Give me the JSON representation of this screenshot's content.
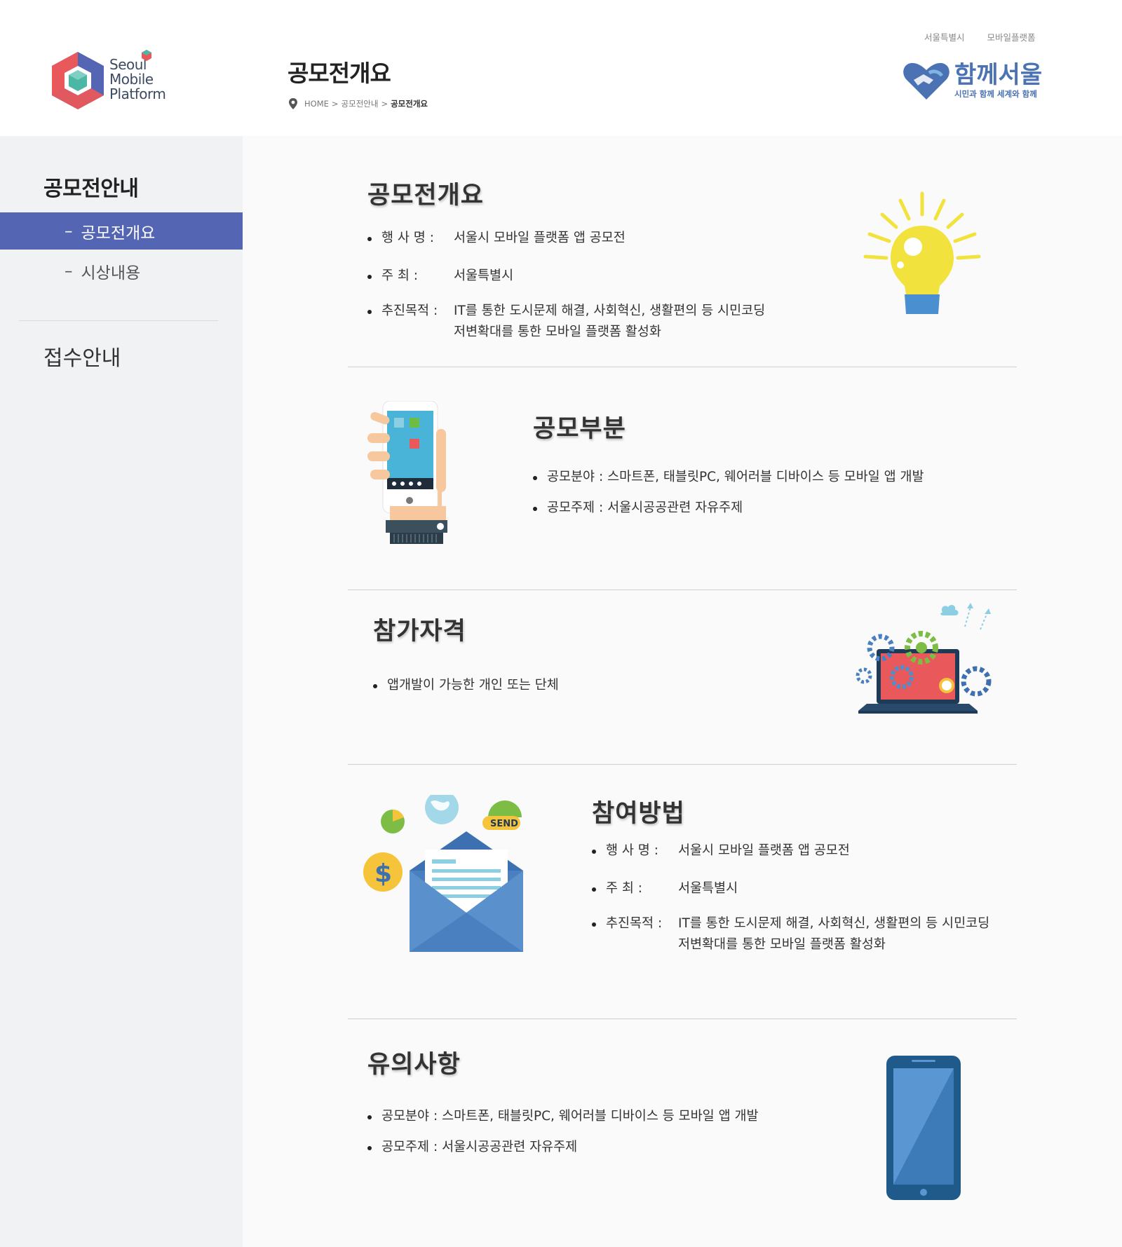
{
  "header": {
    "logo": {
      "line1": "Seoul",
      "line2": "Mobile",
      "line3": "Platform"
    },
    "page_title": "공모전개요",
    "breadcrumb": {
      "home": "HOME",
      "sep1": ">",
      "section": "공모전안내",
      "sep2": ">",
      "current": "공모전개요"
    },
    "top_links": [
      "서울특별시",
      "모바일플랫폼"
    ],
    "together_logo": {
      "title": "함께서울",
      "subtitle": "시민과 함께 세계와 함께"
    }
  },
  "sidebar": {
    "title": "공모전안내",
    "items": [
      {
        "label": "공모전개요",
        "active": true
      },
      {
        "label": "시상내용",
        "active": false
      }
    ],
    "title2": "접수안내",
    "dash": "–",
    "active_color": "#5465b3"
  },
  "sections": {
    "overview": {
      "title": "공모전개요",
      "rows": [
        {
          "key": "행 사 명 :",
          "value": "서울시 모바일 플랫폼 앱 공모전"
        },
        {
          "key": "주      최 :",
          "value": "서울특별시"
        },
        {
          "key": "추진목적 :",
          "value": "IT를 통한 도시문제 해결, 사회혁신, 생활편의 등 시민코딩",
          "value2": "저변확대를 통한 모바일 플랫폼 활성화"
        }
      ],
      "icon": "lightbulb-icon"
    },
    "category": {
      "title": "공모부분",
      "items": [
        "공모분야 : 스마트폰, 태블릿PC, 웨어러블 디바이스 등 모바일 앱 개발",
        "공모주제 : 서울시공공관련  자유주제"
      ],
      "icon": "hand-phone-icon"
    },
    "eligibility": {
      "title": "참가자격",
      "items": [
        "앱개발이  가능한 개인 또는 단체"
      ],
      "icon": "laptop-gears-icon"
    },
    "method": {
      "title": "참여방법",
      "rows": [
        {
          "key": "행 사 명 :",
          "value": "서울시 모바일 플랫폼 앱 공모전"
        },
        {
          "key": "주      최 :",
          "value": "서울특별시"
        },
        {
          "key": "추진목적 :",
          "value": "IT를 통한 도시문제 해결, 사회혁신, 생활편의 등 시민코딩",
          "value2": "저변확대를 통한 모바일 플랫폼 활성화"
        }
      ],
      "icon": "envelope-send-icon",
      "send_label": "SEND"
    },
    "notes": {
      "title": "유의사항",
      "items": [
        "공모분야 : 스마트폰, 태블릿PC, 웨어러블 디바이스 등 모바일 앱 개발",
        "공모주제 : 서울시공공관련  자유주제"
      ],
      "icon": "smartphone-icon"
    }
  }
}
